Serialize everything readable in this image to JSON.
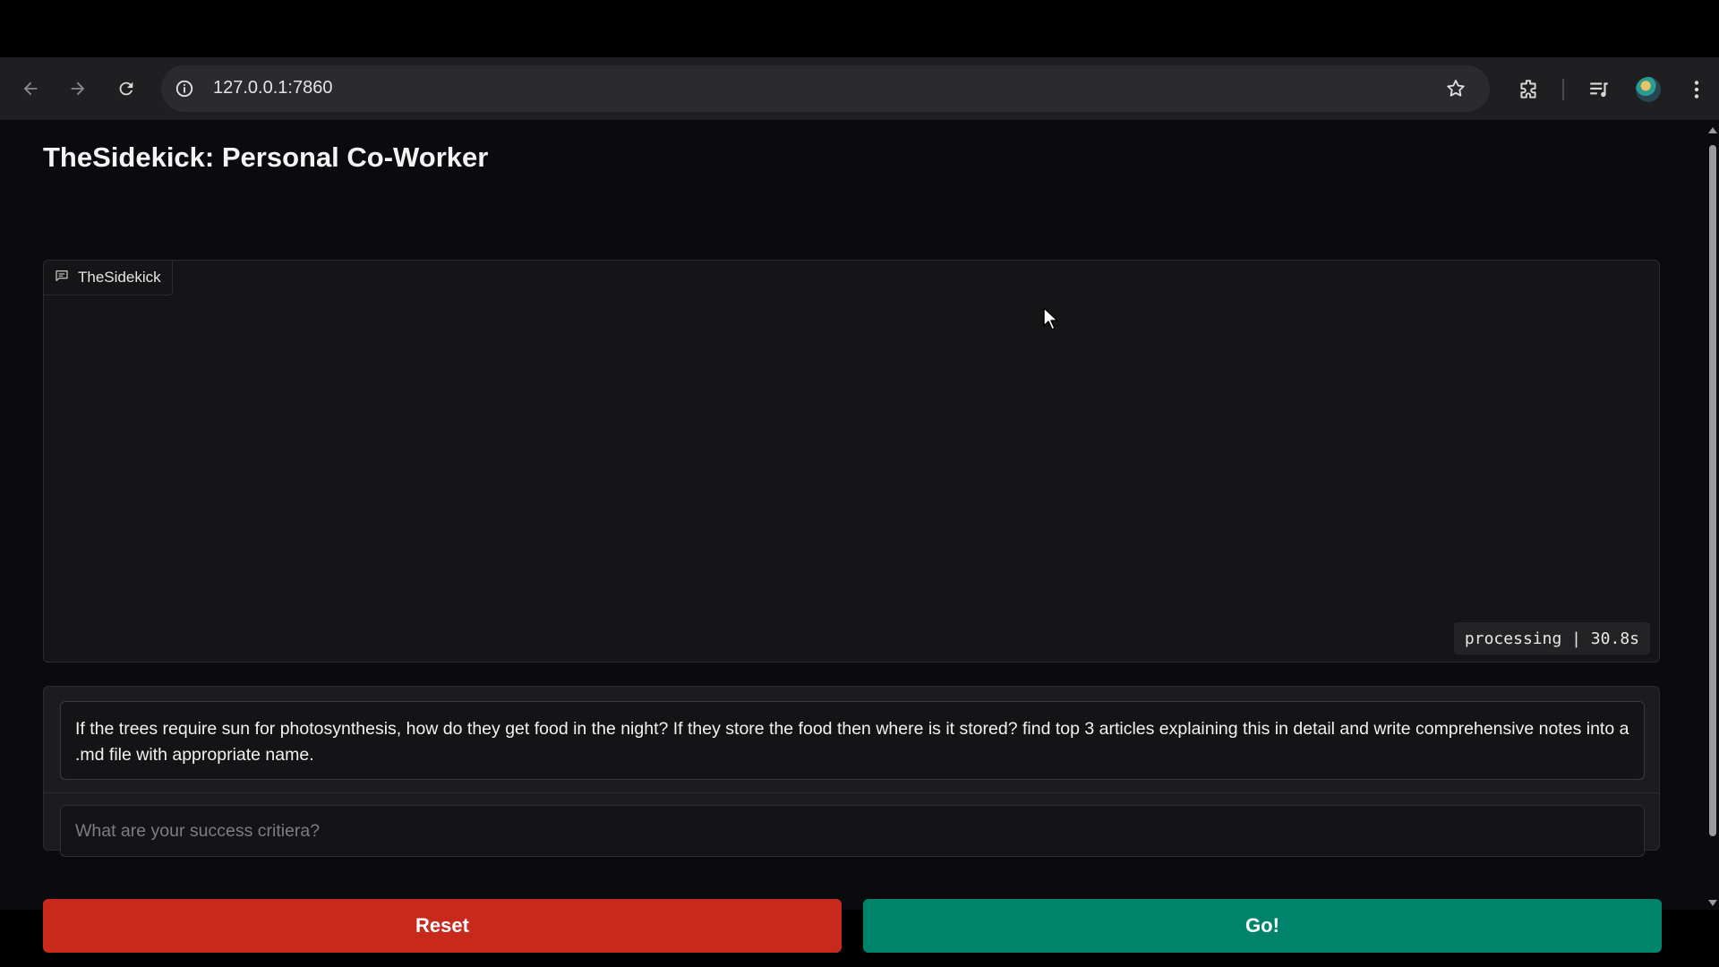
{
  "browser": {
    "url": "127.0.0.1:7860",
    "icons": [
      "back-arrow-icon",
      "forward-arrow-icon",
      "reload-icon",
      "site-info-icon",
      "bookmark-star-icon",
      "extensions-icon",
      "media-controls-icon",
      "profile-avatar",
      "more-menu-icon"
    ]
  },
  "app": {
    "title": "TheSidekick: Personal Co-Worker",
    "chatbot": {
      "label": "TheSidekick",
      "icon": "chat-bubble-icon",
      "status": "processing | 30.8s"
    },
    "message": {
      "value": "If the trees require sun for photosynthesis, how do they get food in the night? If they store the food then where is it stored? find top 3 articles explaining this in detail and write comprehensive notes into a .md file with appropriate name."
    },
    "criteria": {
      "placeholder": "What are your success critiera?",
      "value": ""
    },
    "buttons": {
      "reset": "Reset",
      "go": "Go!"
    }
  },
  "colors": {
    "reset": "#c8291d",
    "go": "#00836b",
    "background": "#0b0b0f"
  }
}
